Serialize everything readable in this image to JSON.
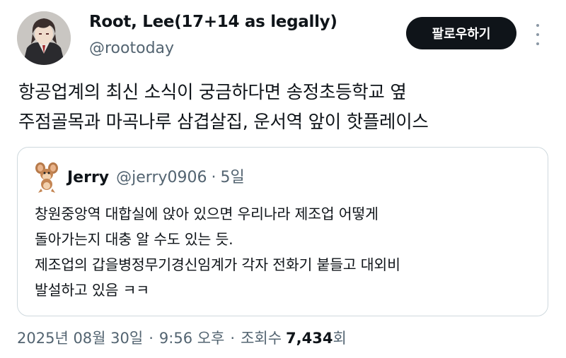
{
  "author": {
    "display_name": "Root, Lee(17+14 as legally)",
    "handle": "@rootoday"
  },
  "follow_button_label": "팔로우하기",
  "tweet": {
    "lines": [
      "항공업계의 최신 소식이 궁금하다면 송정초등학교 옆",
      "주점골목과 마곡나루 삼겹살집, 운서역 앞이 핫플레이스"
    ]
  },
  "quote": {
    "name": "Jerry",
    "handle": "@jerry0906",
    "separator": "·",
    "time": "5일",
    "lines": [
      "창원중앙역 대합실에 앉아 있으면 우리나라 제조업 어떻게",
      "돌아가는지 대충 알 수도 있는 듯.",
      "제조업의 갑을병정무기경신임계가 각자 전화기 붙들고 대외비",
      "발설하고 있음 ㅋㅋ"
    ]
  },
  "meta": {
    "date": "2025년 08월 30일",
    "time": "9:56 오후",
    "views_label": "조회수",
    "views_count": "7,434",
    "views_suffix": "회",
    "separator": "·"
  },
  "icons": {
    "more": "more-vertical-icon",
    "author_avatar": "anime-character-avatar",
    "quote_avatar": "jerry-mouse-avatar"
  },
  "colors": {
    "text_primary": "#0f1419",
    "text_secondary": "#536471",
    "button_bg": "#0f1419",
    "border": "#cfd9de"
  }
}
